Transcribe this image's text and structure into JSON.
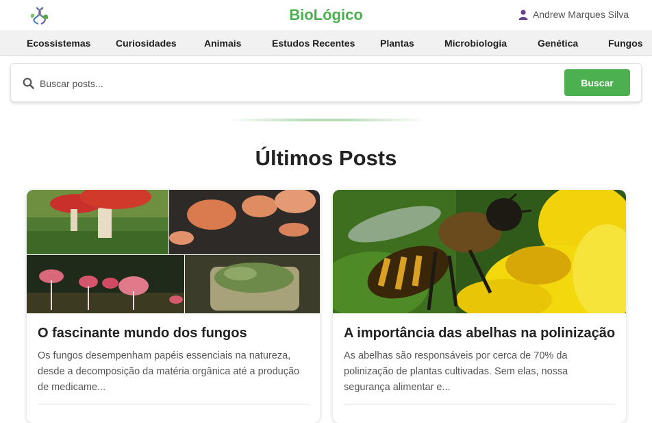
{
  "header": {
    "logo_icon": "dna-leaf-logo-icon",
    "title": "BioLógico",
    "user_icon": "user-icon",
    "user_name": "Andrew Marques Silva",
    "accent_color": "#4caf50"
  },
  "nav": {
    "items": [
      {
        "label": "Ecossistemas"
      },
      {
        "label": "Curiosidades"
      },
      {
        "label": "Animais"
      },
      {
        "label": "Estudos Recentes"
      },
      {
        "label": "Plantas"
      },
      {
        "label": "Microbiologia"
      },
      {
        "label": "Genética"
      },
      {
        "label": "Fungos"
      }
    ]
  },
  "search": {
    "icon": "search-icon",
    "placeholder": "Buscar posts...",
    "value": "",
    "button_label": "Buscar"
  },
  "section": {
    "title": "Últimos Posts"
  },
  "posts": [
    {
      "image": "fungi-collage-photo",
      "title": "O fascinante mundo dos fungos",
      "excerpt": "Os fungos desempenham papéis essenciais na natureza, desde a decomposição da matéria orgânica até a produção de medicame..."
    },
    {
      "image": "bee-on-yellow-flower-photo",
      "title": "A importância das abelhas na polinização",
      "excerpt": "As abelhas são responsáveis por cerca de 70% da polinização de plantas cultivadas. Sem elas, nossa segurança alimentar e..."
    }
  ]
}
